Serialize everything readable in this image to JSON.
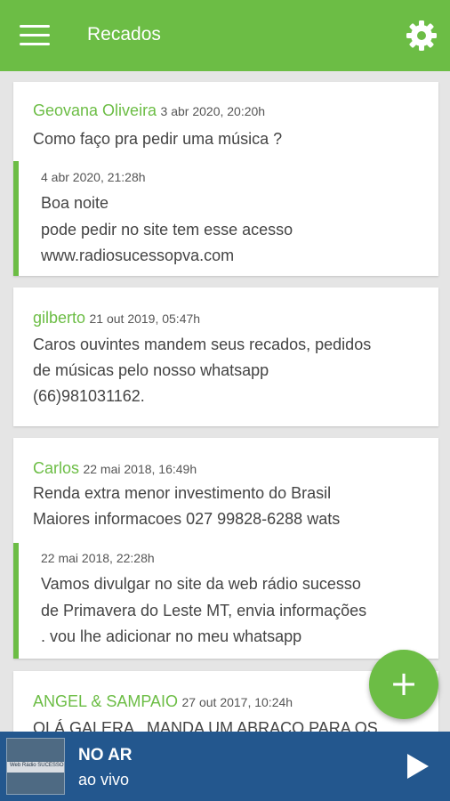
{
  "app_bar": {
    "title": "Recados",
    "menu_icon": "hamburger-menu-icon",
    "settings_icon": "gear-icon"
  },
  "messages": [
    {
      "author": "Geovana Oliveira",
      "date": "3 abr 2020, 20:20h",
      "text": "Como faço pra pedir uma música ?",
      "reply": {
        "date": "4 abr 2020, 21:28h",
        "lines": [
          "Boa noite",
          "pode pedir no site tem esse acesso",
          "www.radiosucessopva.com"
        ]
      }
    },
    {
      "author": "gilberto",
      "date": "21 out 2019, 05:47h",
      "text_lines": [
        "Caros ouvintes mandem seus recados, pedidos",
        "de músicas pelo nosso whatsapp",
        "(66)981031162."
      ]
    },
    {
      "author": "Carlos",
      "date": "22 mai 2018, 16:49h",
      "text_lines": [
        "Renda extra menor investimento do Brasil",
        "Maiores informacoes 027 99828-6288 wats"
      ],
      "reply": {
        "date": "22 mai 2018, 22:28h",
        "lines": [
          "Vamos divulgar no site da web rádio sucesso",
          "de Primavera do Leste MT, envia informações",
          ". vou lhe adicionar no meu whatsapp"
        ]
      }
    },
    {
      "author": "ANGEL & SAMPAIO",
      "date": "27 out 2017, 10:24h",
      "text": "OLÁ GALERA , MANDA UM ABRAÇO PARA OS"
    }
  ],
  "fab": {
    "label": "+",
    "icon": "plus-icon"
  },
  "player": {
    "title": "NO AR",
    "subtitle": "ao vivo",
    "thumbnail_text": "Web Rádio SUCESSO",
    "play_icon": "play-icon"
  },
  "colors": {
    "accent": "#6cbd45",
    "player_bg": "#23578e",
    "background": "#e5e5e5"
  }
}
